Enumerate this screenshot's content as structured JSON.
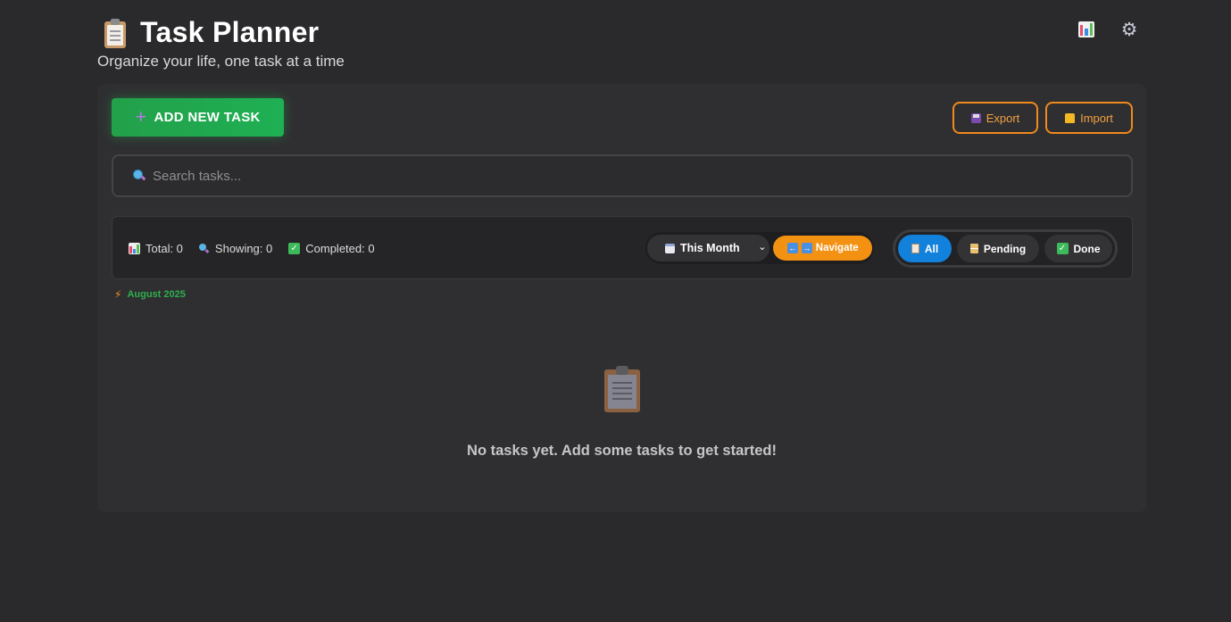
{
  "header": {
    "title": "Task Planner",
    "subtitle": "Organize your life, one task at a time",
    "icons": {
      "title_icon": "clipboard-icon",
      "stats_icon": "bar-chart-icon",
      "settings_icon": "gear-icon"
    }
  },
  "actions": {
    "add_task_label": "ADD NEW TASK",
    "export_label": "Export",
    "import_label": "Import"
  },
  "search": {
    "placeholder": "Search tasks..."
  },
  "stats": {
    "total_label": "Total: 0",
    "showing_label": "Showing: 0",
    "completed_label": "Completed: 0"
  },
  "period": {
    "selected": "This Month",
    "navigate_label": "Navigate"
  },
  "filters": {
    "all_label": "All",
    "pending_label": "Pending",
    "done_label": "Done",
    "active": "All"
  },
  "date_group": {
    "label": "August 2025"
  },
  "empty_state": {
    "message": "No tasks yet. Add some tasks to get started!"
  },
  "colors": {
    "background": "#2a2a2c",
    "primary_green": "#22a04a",
    "accent_orange": "#f08a1c",
    "active_blue": "#1281dc"
  }
}
